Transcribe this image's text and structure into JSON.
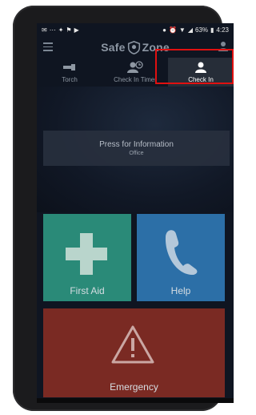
{
  "status": {
    "battery": "63%",
    "time": "4:23"
  },
  "app": {
    "title_left": "Safe",
    "title_right": "Zone"
  },
  "tabs": [
    {
      "label": "Torch",
      "icon": "torch-icon"
    },
    {
      "label": "Check In Timer",
      "icon": "timer-icon"
    },
    {
      "label": "Check In",
      "icon": "person-icon",
      "selected": true
    }
  ],
  "info": {
    "title": "Press for Information",
    "subtitle": "Office"
  },
  "tiles": {
    "first_aid": "First Aid",
    "help": "Help",
    "emergency": "Emergency"
  },
  "colors": {
    "first_aid": "#2a8a78",
    "help": "#2c6fa7",
    "emergency": "#7a2a23",
    "highlight": "#e01010"
  }
}
